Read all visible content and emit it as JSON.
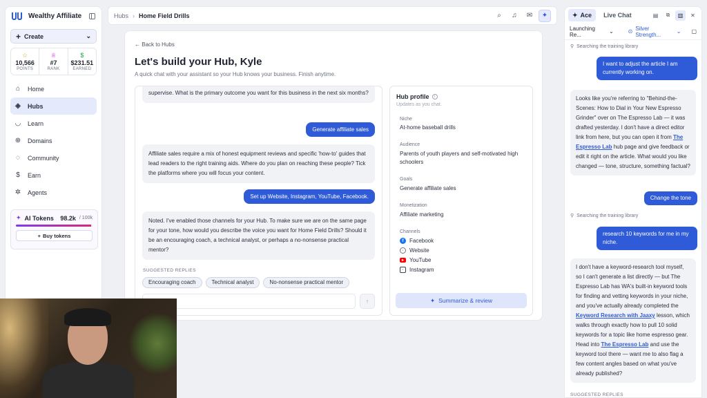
{
  "app": {
    "name": "Wealthy Affiliate",
    "create_label": "Create"
  },
  "stats": [
    {
      "icon": "star-icon",
      "value": "10,566",
      "label": "POINTS"
    },
    {
      "icon": "trophy-icon",
      "value": "#7",
      "label": "RANK"
    },
    {
      "icon": "dollar-icon",
      "value": "$231.51",
      "label": "EARNED"
    }
  ],
  "nav": [
    {
      "label": "Home",
      "icon": "home-icon"
    },
    {
      "label": "Hubs",
      "icon": "layers-icon",
      "active": true
    },
    {
      "label": "Learn",
      "icon": "learn-icon"
    },
    {
      "label": "Domains",
      "icon": "globe-icon"
    },
    {
      "label": "Community",
      "icon": "community-icon"
    },
    {
      "label": "Earn",
      "icon": "dollar-icon"
    },
    {
      "label": "Agents",
      "icon": "agents-icon"
    }
  ],
  "tokens": {
    "label": "AI Tokens",
    "value": "98.2k",
    "max": "/ 100k",
    "fraction_used": 0.982,
    "buy_label": "Buy tokens"
  },
  "breadcrumb": {
    "root": "Hubs",
    "current": "Home Field Drills"
  },
  "main": {
    "back_label": "Back to Hubs",
    "title": "Let's build your Hub, Kyle",
    "subtitle": "A quick chat with your assistant so your Hub knows your business. Finish anytime."
  },
  "chat": {
    "messages": [
      {
        "role": "assistant",
        "text": "supervise. What is the primary outcome you want for this business in the next six months?"
      },
      {
        "role": "user",
        "text": "Generate affiliate sales"
      },
      {
        "role": "assistant",
        "text": "Affiliate sales require a mix of honest equipment reviews and specific 'how-to' guides that lead readers to the right training aids. Where do you plan on reaching these people? Tick the platforms where you will focus your content."
      },
      {
        "role": "user",
        "text": "Set up Website, Instagram, YouTube, Facebook."
      },
      {
        "role": "assistant",
        "text": "Noted. I've enabled those channels for your Hub. To make sure we are on the same page for your tone, how would you describe the voice you want for Home Field Drills? Should it be an encouraging coach, a technical analyst, or perhaps a no-nonsense practical mentor?"
      }
    ],
    "suggested_label": "SUGGESTED REPLIES",
    "suggested": [
      "Encouraging coach",
      "Technical analyst",
      "No-nonsense practical mentor"
    ],
    "input_value": ""
  },
  "profile": {
    "title": "Hub profile",
    "subtitle": "Updates as you chat.",
    "niche_label": "Niche",
    "niche": "At-home baseball drills",
    "audience_label": "Audience",
    "audience": "Parents of youth players and self-motivated high schoolers",
    "goals_label": "Goals",
    "goals": "Generate affiliate sales",
    "monetization_label": "Monetization",
    "monetization": "Affiliate marketing",
    "channels_label": "Channels",
    "channels": [
      {
        "name": "Facebook",
        "icon": "facebook-icon",
        "color": "#1877f2"
      },
      {
        "name": "Website",
        "icon": "globe-icon",
        "color": "#6b7280"
      },
      {
        "name": "YouTube",
        "icon": "youtube-icon",
        "color": "#ff0000"
      },
      {
        "name": "Instagram",
        "icon": "instagram-icon",
        "color": "#374151"
      }
    ],
    "summarize_label": "Summarize & review"
  },
  "ace": {
    "tab_ace": "Ace",
    "tab_live": "Live Chat",
    "context_left": "Launching Re...",
    "context_right": "Silver Strength...",
    "search_note": "Searching the training library",
    "user_1": "I want to adjust the article I am currently working on.",
    "bot_1": {
      "pre": "Looks like you're referring to \"Behind-the-Scenes: How to Dial in Your New Espresso Grinder\" over on The Espresso Lab — it was drafted yesterday. I don't have a direct editor link from here, but you can open it from ",
      "link": "The Espresso Lab",
      "post": " hub page and give feedback or edit it right on the article. What would you like changed — tone, structure, something factual?"
    },
    "user_2": "Change the tone",
    "user_3": "research 10 keywords for me in my niche.",
    "bot_2": {
      "pre": "I don't have a keyword-research tool myself, so I can't generate a list directly — but The Espresso Lab has WA's built-in keyword tools for finding and vetting keywords in your niche, and you've actually already completed the ",
      "link1": "Keyword Research with Jaaxy",
      "mid": " lesson, which walks through exactly how to pull 10 solid keywords for a topic like home espresso gear. Head into ",
      "link2": "The Espresso Lab",
      "post": " and use the keyword tool there — want me to also flag a few content angles based on what you've already published?"
    },
    "suggested_label": "SUGGESTED REPLIES"
  }
}
